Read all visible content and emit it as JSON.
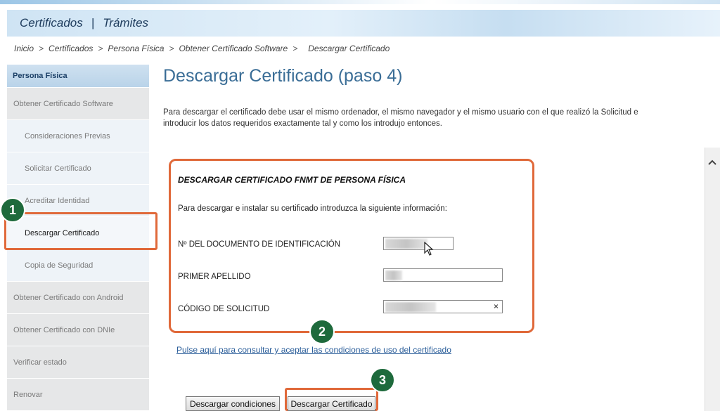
{
  "header": {
    "left": "Certificados",
    "separator": "|",
    "right": "Trámites"
  },
  "breadcrumb": {
    "items": [
      "Inicio",
      "Certificados",
      "Persona Física",
      "Obtener Certificado Software"
    ],
    "arrow": ">",
    "current": "Descargar Certificado"
  },
  "sidebar": {
    "heading": "Persona Física",
    "items": [
      {
        "label": "Obtener Certificado Software"
      },
      {
        "label": "Consideraciones Previas"
      },
      {
        "label": "Solicitar Certificado"
      },
      {
        "label": "Acreditar Identidad"
      },
      {
        "label": "Descargar Certificado"
      },
      {
        "label": "Copia de Seguridad"
      },
      {
        "label": "Obtener Certificado con Android"
      },
      {
        "label": "Obtener Certificado con DNIe"
      },
      {
        "label": "Verificar estado"
      },
      {
        "label": "Renovar"
      }
    ]
  },
  "main": {
    "title": "Descargar Certificado (paso 4)",
    "intro_line1": "Para descargar el certificado debe usar el mismo ordenador, el mismo navegador y el mismo usuario con el que realizó la Solicitud e",
    "intro_line2": "introducir los datos requeridos exactamente tal y como los introdujo entonces."
  },
  "form": {
    "title": "DESCARGAR CERTIFICADO FNMT DE PERSONA FÍSICA",
    "info": "Para descargar e instalar su certificado introduzca la siguiente información:",
    "fields": {
      "doc_label": "Nº DEL DOCUMENTO DE IDENTIFICACIÓN",
      "apellido_label": "PRIMER APELLIDO",
      "codigo_label": "CÓDIGO DE SOLICITUD"
    },
    "clear_glyph": "×"
  },
  "conditions_link": "Pulse aquí para consultar y aceptar las condiciones de uso del certificado",
  "buttons": {
    "conditions": "Descargar condiciones",
    "download": "Descargar Certificado"
  },
  "markers": [
    "1",
    "2",
    "3"
  ],
  "icons": {
    "scroll_up": "chevron-up-icon",
    "cursor": "mouse-pointer-icon"
  },
  "colors": {
    "highlight": "#e0693a",
    "marker": "#1e6a3c",
    "title": "#3a6d96",
    "link": "#2b5e9a"
  }
}
